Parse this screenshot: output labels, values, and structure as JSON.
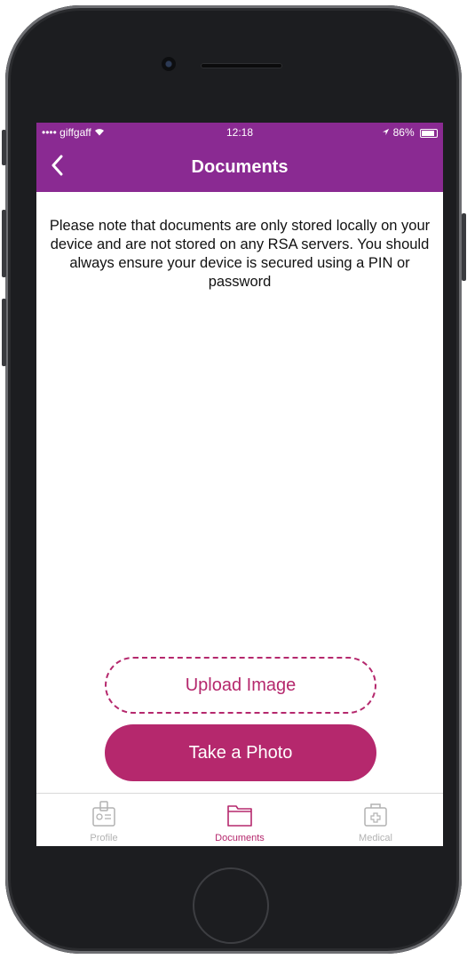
{
  "status_bar": {
    "carrier": "•••• giffgaff",
    "time": "12:18",
    "battery": "86%"
  },
  "nav": {
    "title": "Documents",
    "back_icon": "chevron-left-icon"
  },
  "notice_text": "Please note that documents are only stored locally on your device and are not stored on any RSA servers. You should always ensure your device is secured using a PIN or password",
  "buttons": {
    "upload_label": "Upload Image",
    "photo_label": "Take a Photo"
  },
  "tabs": [
    {
      "label": "Profile",
      "icon": "id-badge-icon",
      "active": false
    },
    {
      "label": "Documents",
      "icon": "folder-icon",
      "active": true
    },
    {
      "label": "Medical",
      "icon": "medical-kit-icon",
      "active": false
    }
  ],
  "colors": {
    "brand_purple": "#8a2a92",
    "accent_magenta": "#b5286d",
    "inactive_gray": "#b2b2b2"
  }
}
